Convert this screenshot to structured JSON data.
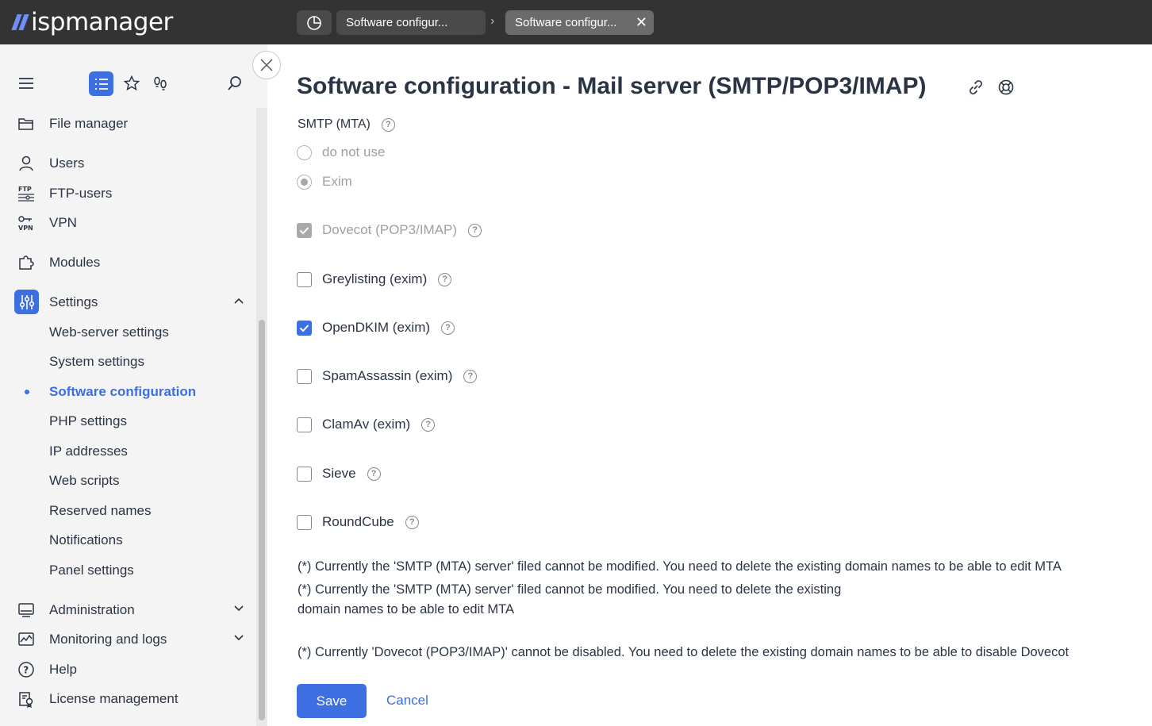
{
  "app": {
    "logo_text": "ispmanager",
    "accent": "#3d6fe0"
  },
  "tabs": [
    {
      "label": "Software configur..."
    },
    {
      "label": "Software configur..."
    }
  ],
  "sidebar": {
    "items": [
      {
        "label": "File manager",
        "icon": "folder-icon"
      },
      {
        "label": "Users",
        "icon": "user-icon"
      },
      {
        "label": "FTP-users",
        "icon": "ftp-icon"
      },
      {
        "label": "VPN",
        "icon": "vpn-icon"
      },
      {
        "label": "Modules",
        "icon": "puzzle-icon"
      },
      {
        "label": "Settings",
        "icon": "sliders-icon"
      },
      {
        "label": "Administration",
        "icon": "monitor-icon"
      },
      {
        "label": "Monitoring and logs",
        "icon": "chart-icon"
      },
      {
        "label": "Help",
        "icon": "help-icon"
      },
      {
        "label": "License management",
        "icon": "license-icon"
      }
    ],
    "settings_sub": [
      "Web-server settings",
      "System settings",
      "Software configuration",
      "PHP settings",
      "IP addresses",
      "Web scripts",
      "Reserved names",
      "Notifications",
      "Panel settings"
    ]
  },
  "main": {
    "title": "Software configuration - Mail server (SMTP/POP3/IMAP)",
    "smtp_label": "SMTP (MTA)",
    "radio_do_not_use": "do not use",
    "radio_exim": "Exim",
    "checkboxes": [
      {
        "label": "Dovecot (POP3/IMAP)",
        "state": "disabled-checked"
      },
      {
        "label": "Greylisting (exim)",
        "state": "unchecked"
      },
      {
        "label": "OpenDKIM (exim)",
        "state": "checked"
      },
      {
        "label": "SpamAssassin (exim)",
        "state": "unchecked"
      },
      {
        "label": "ClamAv (exim)",
        "state": "unchecked"
      },
      {
        "label": "Sieve",
        "state": "unchecked"
      },
      {
        "label": "RoundCube",
        "state": "unchecked"
      }
    ],
    "note1": "(*) Currently the 'SMTP (MTA) server' filed cannot be modified. You need to delete the existing domain names to be able to edit MTA",
    "note2a": "(*) Currently the 'SMTP (MTA) server' filed cannot be modified. You need to delete the existing",
    "note2b": "domain names to be able to edit MTA",
    "note3": "(*) Currently 'Dovecot (POP3/IMAP)' cannot be disabled. You need to delete the existing domain names to be able to disable Dovecot",
    "help_mark": "?"
  },
  "footer": {
    "save": "Save",
    "cancel": "Cancel"
  }
}
